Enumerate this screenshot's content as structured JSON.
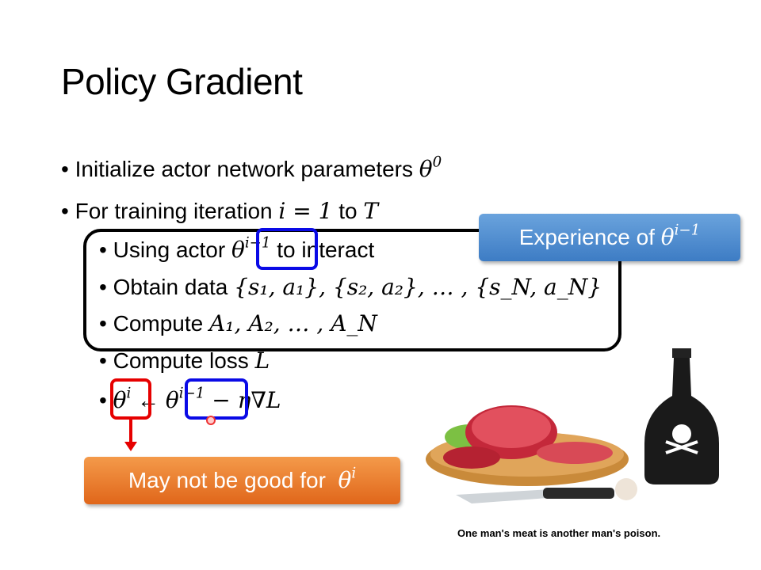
{
  "title": "Policy Gradient",
  "bullets": {
    "b1_text": "Initialize actor network parameters ",
    "b1_math": "θ",
    "b1_sup": "0",
    "b2_text": "For training iteration ",
    "b2_math": "i = 1",
    "b2_to": " to ",
    "b2_T": "T"
  },
  "sub_bullets": {
    "s1_pre": "Using actor ",
    "s1_theta": "θ",
    "s1_sup": "i−1",
    "s1_post": " to interact",
    "s2_pre": "Obtain data ",
    "s2_math": "{s₁, a₁}, {s₂, a₂}, … , {s_N, a_N}",
    "s3_pre": "Compute ",
    "s3_math": "A₁, A₂, … , A_N",
    "s4_pre": "Compute loss ",
    "s4_math": "L",
    "s5_theta": "θ",
    "s5_sup": "i",
    "s5_arrow": " ← ",
    "s5_theta2": "θ",
    "s5_sup2": "i−1",
    "s5_rest": " − η∇L"
  },
  "callout": {
    "text": "Experience of ",
    "theta": "θ",
    "sup": "i−1",
    "color": "#4a8ad0"
  },
  "warning": {
    "text": "May not be good for ",
    "theta": "θ",
    "sup": "i",
    "color": "#ea7a2e"
  },
  "caption": "One man's meat is another man's poison.",
  "colors": {
    "blue_box": "#0a0ae6",
    "red_box": "#e60000"
  }
}
